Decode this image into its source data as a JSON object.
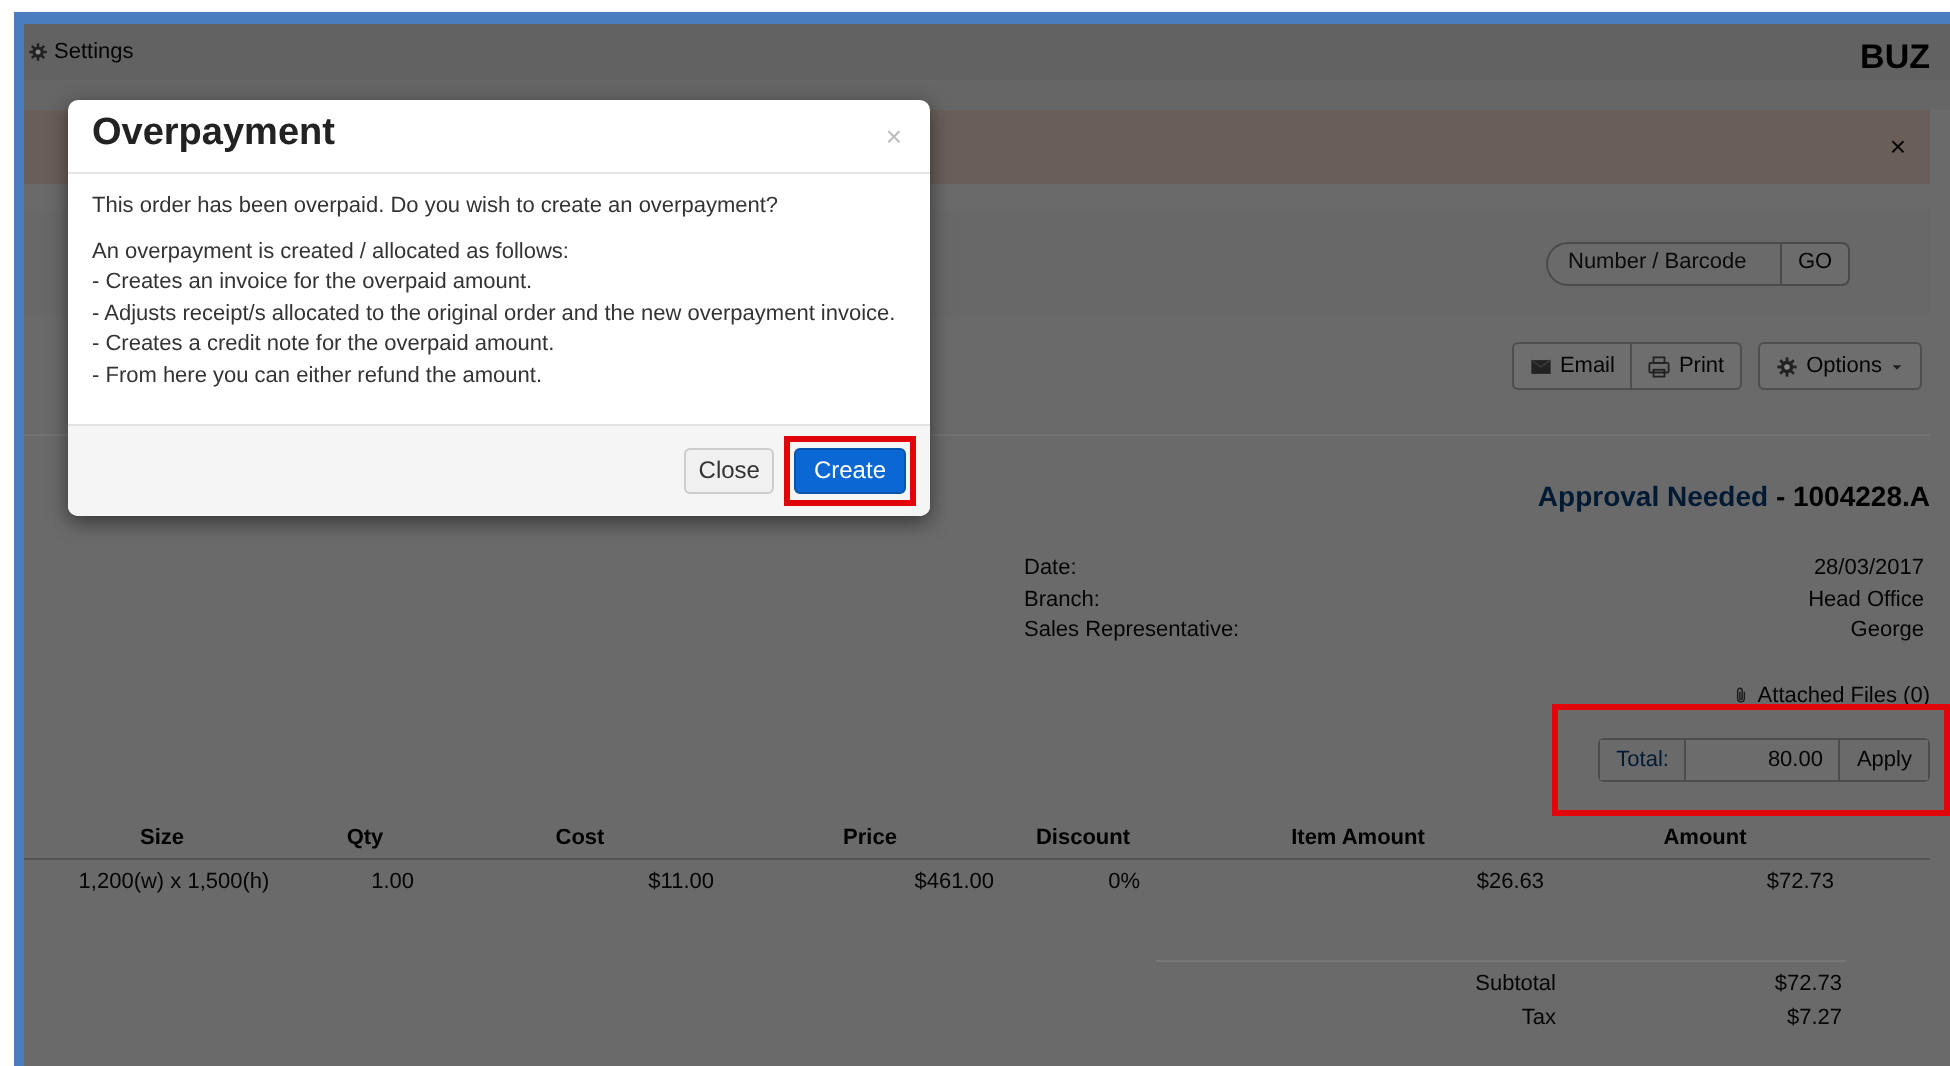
{
  "nav": {
    "title": "Settings",
    "logo": "BUZ"
  },
  "alert": {
    "close": "×"
  },
  "search": {
    "placeholder": "Number / Barcode",
    "button": "GO"
  },
  "actions": [
    {
      "label": "Email",
      "kind": "email"
    },
    {
      "label": "Print",
      "kind": "print"
    },
    {
      "label": "Options",
      "kind": "options"
    }
  ],
  "status": {
    "label": "Approval Needed",
    "number": "- 1004228.A"
  },
  "details": [
    {
      "label": "Date:",
      "value": "28/03/2017"
    },
    {
      "label": "Branch:",
      "value": "Head Office"
    },
    {
      "label": "Sales Representative:",
      "value": "George"
    }
  ],
  "attachments": "Attached Files (0)",
  "total": {
    "label": "Total:",
    "value": "80.00",
    "button": "Apply",
    "highlighted": true
  },
  "table": {
    "columns": [
      "Size",
      "Qty",
      "Cost",
      "Price",
      "Discount",
      "Item Amount",
      "Amount"
    ],
    "rows": [
      [
        "1,200(w) x 1,500(h)",
        "1.00",
        "$11.00",
        "$461.00",
        "0%",
        "$26.63",
        "$72.73"
      ]
    ]
  },
  "totals": [
    {
      "label": "Subtotal",
      "value": "$72.73"
    },
    {
      "label": "Tax",
      "value": "$7.27"
    }
  ],
  "modal": {
    "title": "Overpayment",
    "close": "×",
    "question": "This order has been overpaid. Do you wish to create an overpayment?",
    "lines": [
      "An overpayment is created / allocated as follows:",
      "- Creates an invoice for the overpaid amount.",
      "- Adjusts receipt/s allocated to the original order and the new overpayment invoice.",
      "- Creates a credit note for the overpaid amount.",
      "- From here you can either refund the amount."
    ],
    "buttons": [
      {
        "label": "Close",
        "kind": "default",
        "highlighted": false
      },
      {
        "label": "Create",
        "kind": "primary",
        "highlighted": true
      }
    ]
  }
}
